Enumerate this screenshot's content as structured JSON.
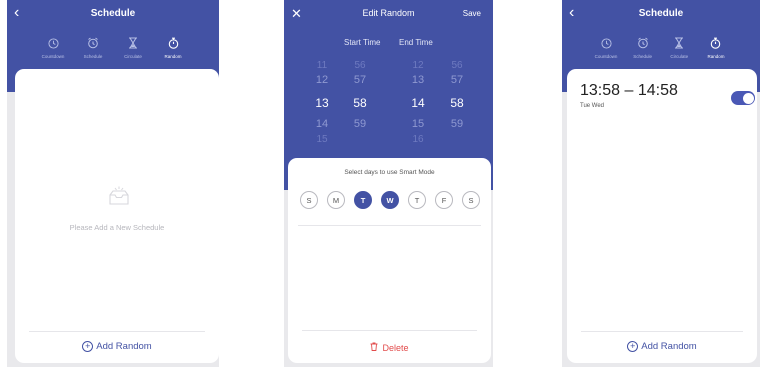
{
  "screen1": {
    "title": "Schedule",
    "tabs": [
      {
        "label": "Countdown",
        "icon": "clock-icon"
      },
      {
        "label": "Schedule",
        "icon": "alarm-clock-icon"
      },
      {
        "label": "Circulate",
        "icon": "hourglass-icon"
      },
      {
        "label": "Random",
        "icon": "stopwatch-icon"
      }
    ],
    "active_tab": "Random",
    "empty_message": "Please Add a New Schedule",
    "add_label": "Add Random"
  },
  "screen2": {
    "title": "Edit Random",
    "save_label": "Save",
    "start_header": "Start Time",
    "end_header": "End Time",
    "start_hours": [
      "11",
      "12",
      "13",
      "14",
      "15"
    ],
    "start_minutes": [
      "56",
      "57",
      "58",
      "59",
      ""
    ],
    "end_hours": [
      "12",
      "13",
      "14",
      "15",
      "16"
    ],
    "end_minutes": [
      "56",
      "57",
      "58",
      "59",
      ""
    ],
    "selected_start": "13:58",
    "selected_end": "14:58",
    "days_prompt": "Select days to use Smart Mode",
    "days": [
      {
        "label": "S",
        "selected": false
      },
      {
        "label": "M",
        "selected": false
      },
      {
        "label": "T",
        "selected": true
      },
      {
        "label": "W",
        "selected": true
      },
      {
        "label": "T",
        "selected": false
      },
      {
        "label": "F",
        "selected": false
      },
      {
        "label": "S",
        "selected": false
      }
    ],
    "delete_label": "Delete"
  },
  "screen3": {
    "title": "Schedule",
    "tabs": [
      {
        "label": "Countdown"
      },
      {
        "label": "Schedule"
      },
      {
        "label": "Circulate"
      },
      {
        "label": "Random"
      }
    ],
    "entry": {
      "time_range": "13:58 – 14:58",
      "days": "Tue Wed",
      "enabled": true
    },
    "add_label": "Add Random"
  },
  "colors": {
    "header": "#4352a4",
    "accent": "#4352a4",
    "delete": "#e24b4b",
    "background": "#e9e9ec"
  }
}
